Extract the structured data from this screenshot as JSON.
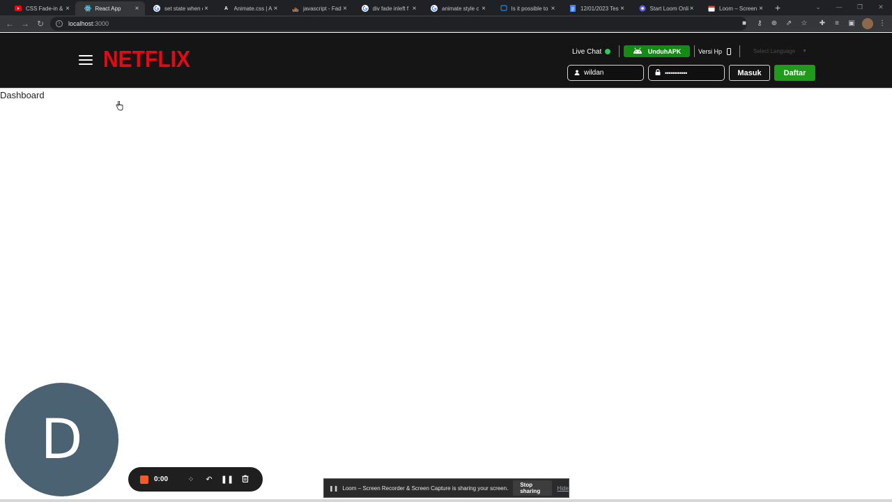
{
  "browser": {
    "tabs": [
      {
        "title": "CSS Fade-in & F",
        "favicon": "youtube-icon",
        "favicon_color": "#ff0000",
        "active": false
      },
      {
        "title": "React App",
        "favicon": "react-icon",
        "favicon_color": "#61dafb",
        "active": true
      },
      {
        "title": "set state when c",
        "favicon": "google-icon",
        "favicon_color": "#4285f4",
        "active": false
      },
      {
        "title": "Animate.css | A",
        "favicon": "animate-icon",
        "favicon_color": "#ffffff",
        "active": false
      },
      {
        "title": "javascript - Fad",
        "favicon": "stackoverflow-icon",
        "favicon_color": "#f48024",
        "active": false
      },
      {
        "title": "div fade inleft f",
        "favicon": "google-icon",
        "favicon_color": "#4285f4",
        "active": false
      },
      {
        "title": "animate style c",
        "favicon": "google-icon",
        "favicon_color": "#4285f4",
        "active": false
      },
      {
        "title": "Is it possible to",
        "favicon": "stackexchange-icon",
        "favicon_color": "#1e88e5",
        "active": false
      },
      {
        "title": "12/01/2023 Tes",
        "favicon": "docs-icon",
        "favicon_color": "#4285f4",
        "active": false
      },
      {
        "title": "Start Loom Onli",
        "favicon": "loom-icon",
        "favicon_color": "#625df5",
        "active": false
      },
      {
        "title": "Loom – Screen R",
        "favicon": "calendar-icon",
        "favicon_color": "#ea4335",
        "active": false
      }
    ],
    "url_host": "localhost",
    "url_port": ":3000"
  },
  "header": {
    "brand": "NETFLIX",
    "live_chat_label": "Live Chat",
    "live_status_color": "#34c759",
    "download_label": "UnduhAPK",
    "mobile_label": "Versi Hp",
    "language_placeholder": "Select Language",
    "username_value": "wildan",
    "password_mask": "••••••••••••",
    "login_label": "Masuk",
    "register_label": "Daftar",
    "accent_green": "#1f9a1b",
    "brand_red": "#e50914"
  },
  "main": {
    "heading": "Dashboard"
  },
  "loom": {
    "avatar_letter": "D",
    "timer": "0:00",
    "share_message": "Loom – Screen Recorder & Screen Capture is sharing your screen.",
    "stop_label": "Stop sharing",
    "hide_label": "Hide"
  }
}
